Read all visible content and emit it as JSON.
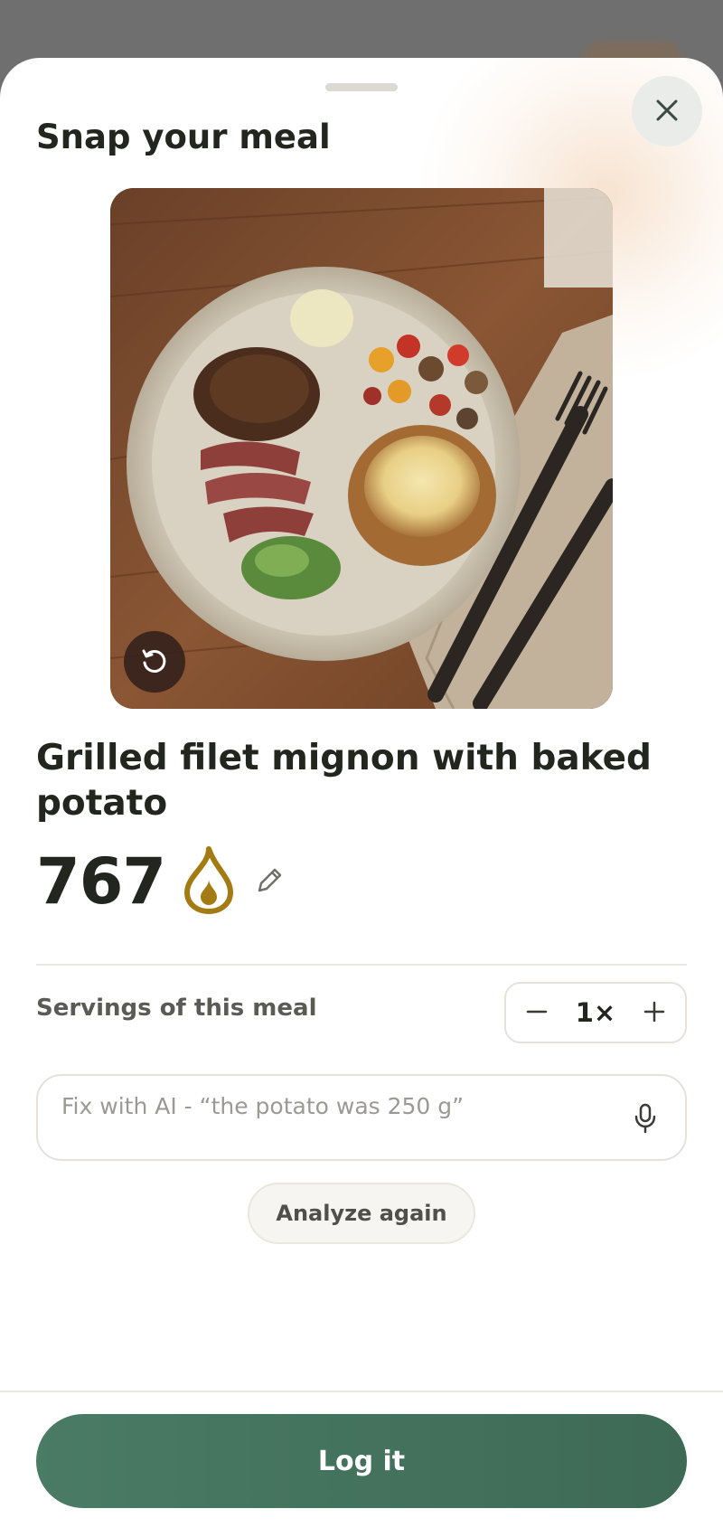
{
  "sheet": {
    "title": "Snap your meal"
  },
  "meal": {
    "name": "Grilled filet mignon with baked potato",
    "calories": "767",
    "calorie_icon": "flame-icon",
    "edit_icon": "pencil-icon"
  },
  "servings": {
    "label": "Servings of this meal",
    "value": "1×",
    "decrement_icon": "minus-icon",
    "increment_icon": "plus-icon"
  },
  "fix_with_ai": {
    "placeholder": "Fix with AI - “the potato was 250 g”",
    "value": "",
    "mic_icon": "microphone-icon"
  },
  "actions": {
    "analyze_again_label": "Analyze again",
    "log_label": "Log it"
  },
  "colors": {
    "primary_green": "#457460",
    "flame_gold": "#a47a12",
    "text_dark": "#23251f"
  }
}
